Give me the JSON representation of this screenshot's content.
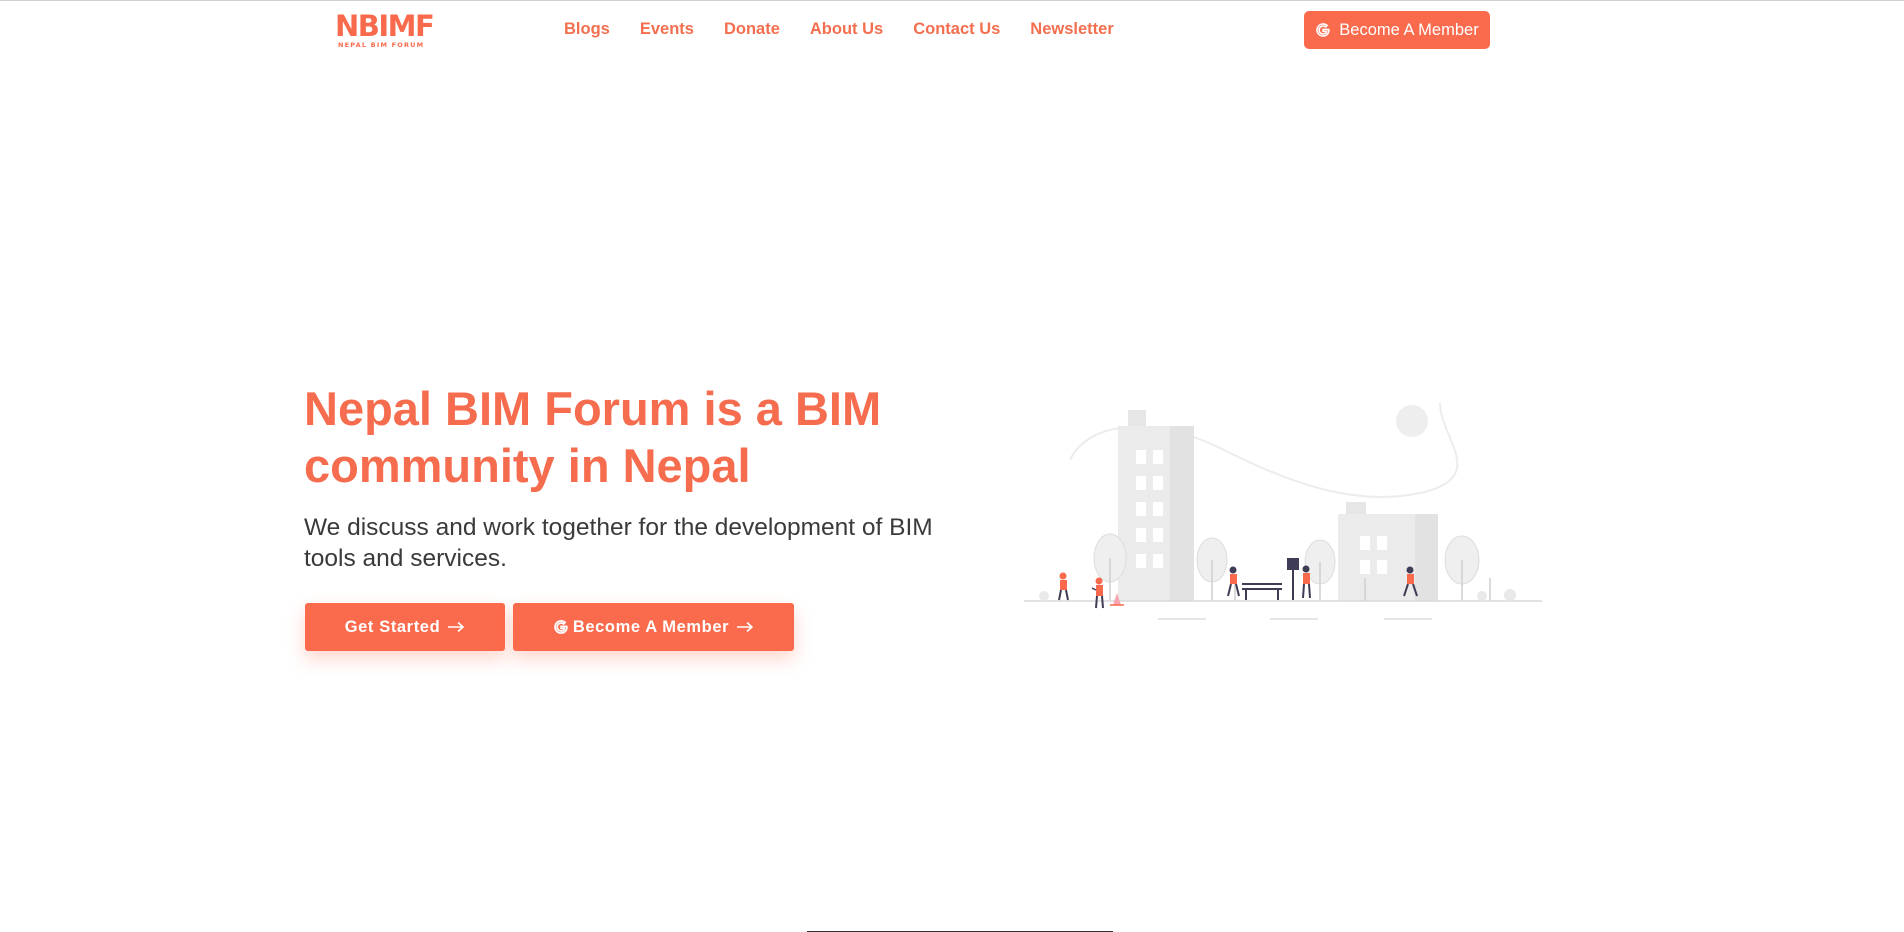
{
  "header": {
    "logo": {
      "name": "NBIMF",
      "tagline": "NEPAL BIM FORUM"
    },
    "nav": [
      {
        "label": "Blogs"
      },
      {
        "label": "Events"
      },
      {
        "label": "Donate"
      },
      {
        "label": "About Us"
      },
      {
        "label": "Contact Us"
      },
      {
        "label": "Newsletter"
      }
    ],
    "cta_label": "Become A Member",
    "cta_icon": "google-icon"
  },
  "hero": {
    "title": "Nepal BIM Forum is a BIM community in Nepal",
    "subtitle": "We discuss and work together for the development of BIM tools and services.",
    "buttons": [
      {
        "label": "Get Started",
        "icon": "arrow-right-icon"
      },
      {
        "label": "Become A Member",
        "icon": "google-icon",
        "trailing_icon": "arrow-right-icon"
      }
    ],
    "illustration": "city-park-illustration"
  },
  "colors": {
    "accent": "#fa6a4c",
    "heading": "#f56c4f",
    "nav_text": "#f36f4f",
    "body_text": "#3a3a3a",
    "background": "#ffffff"
  }
}
